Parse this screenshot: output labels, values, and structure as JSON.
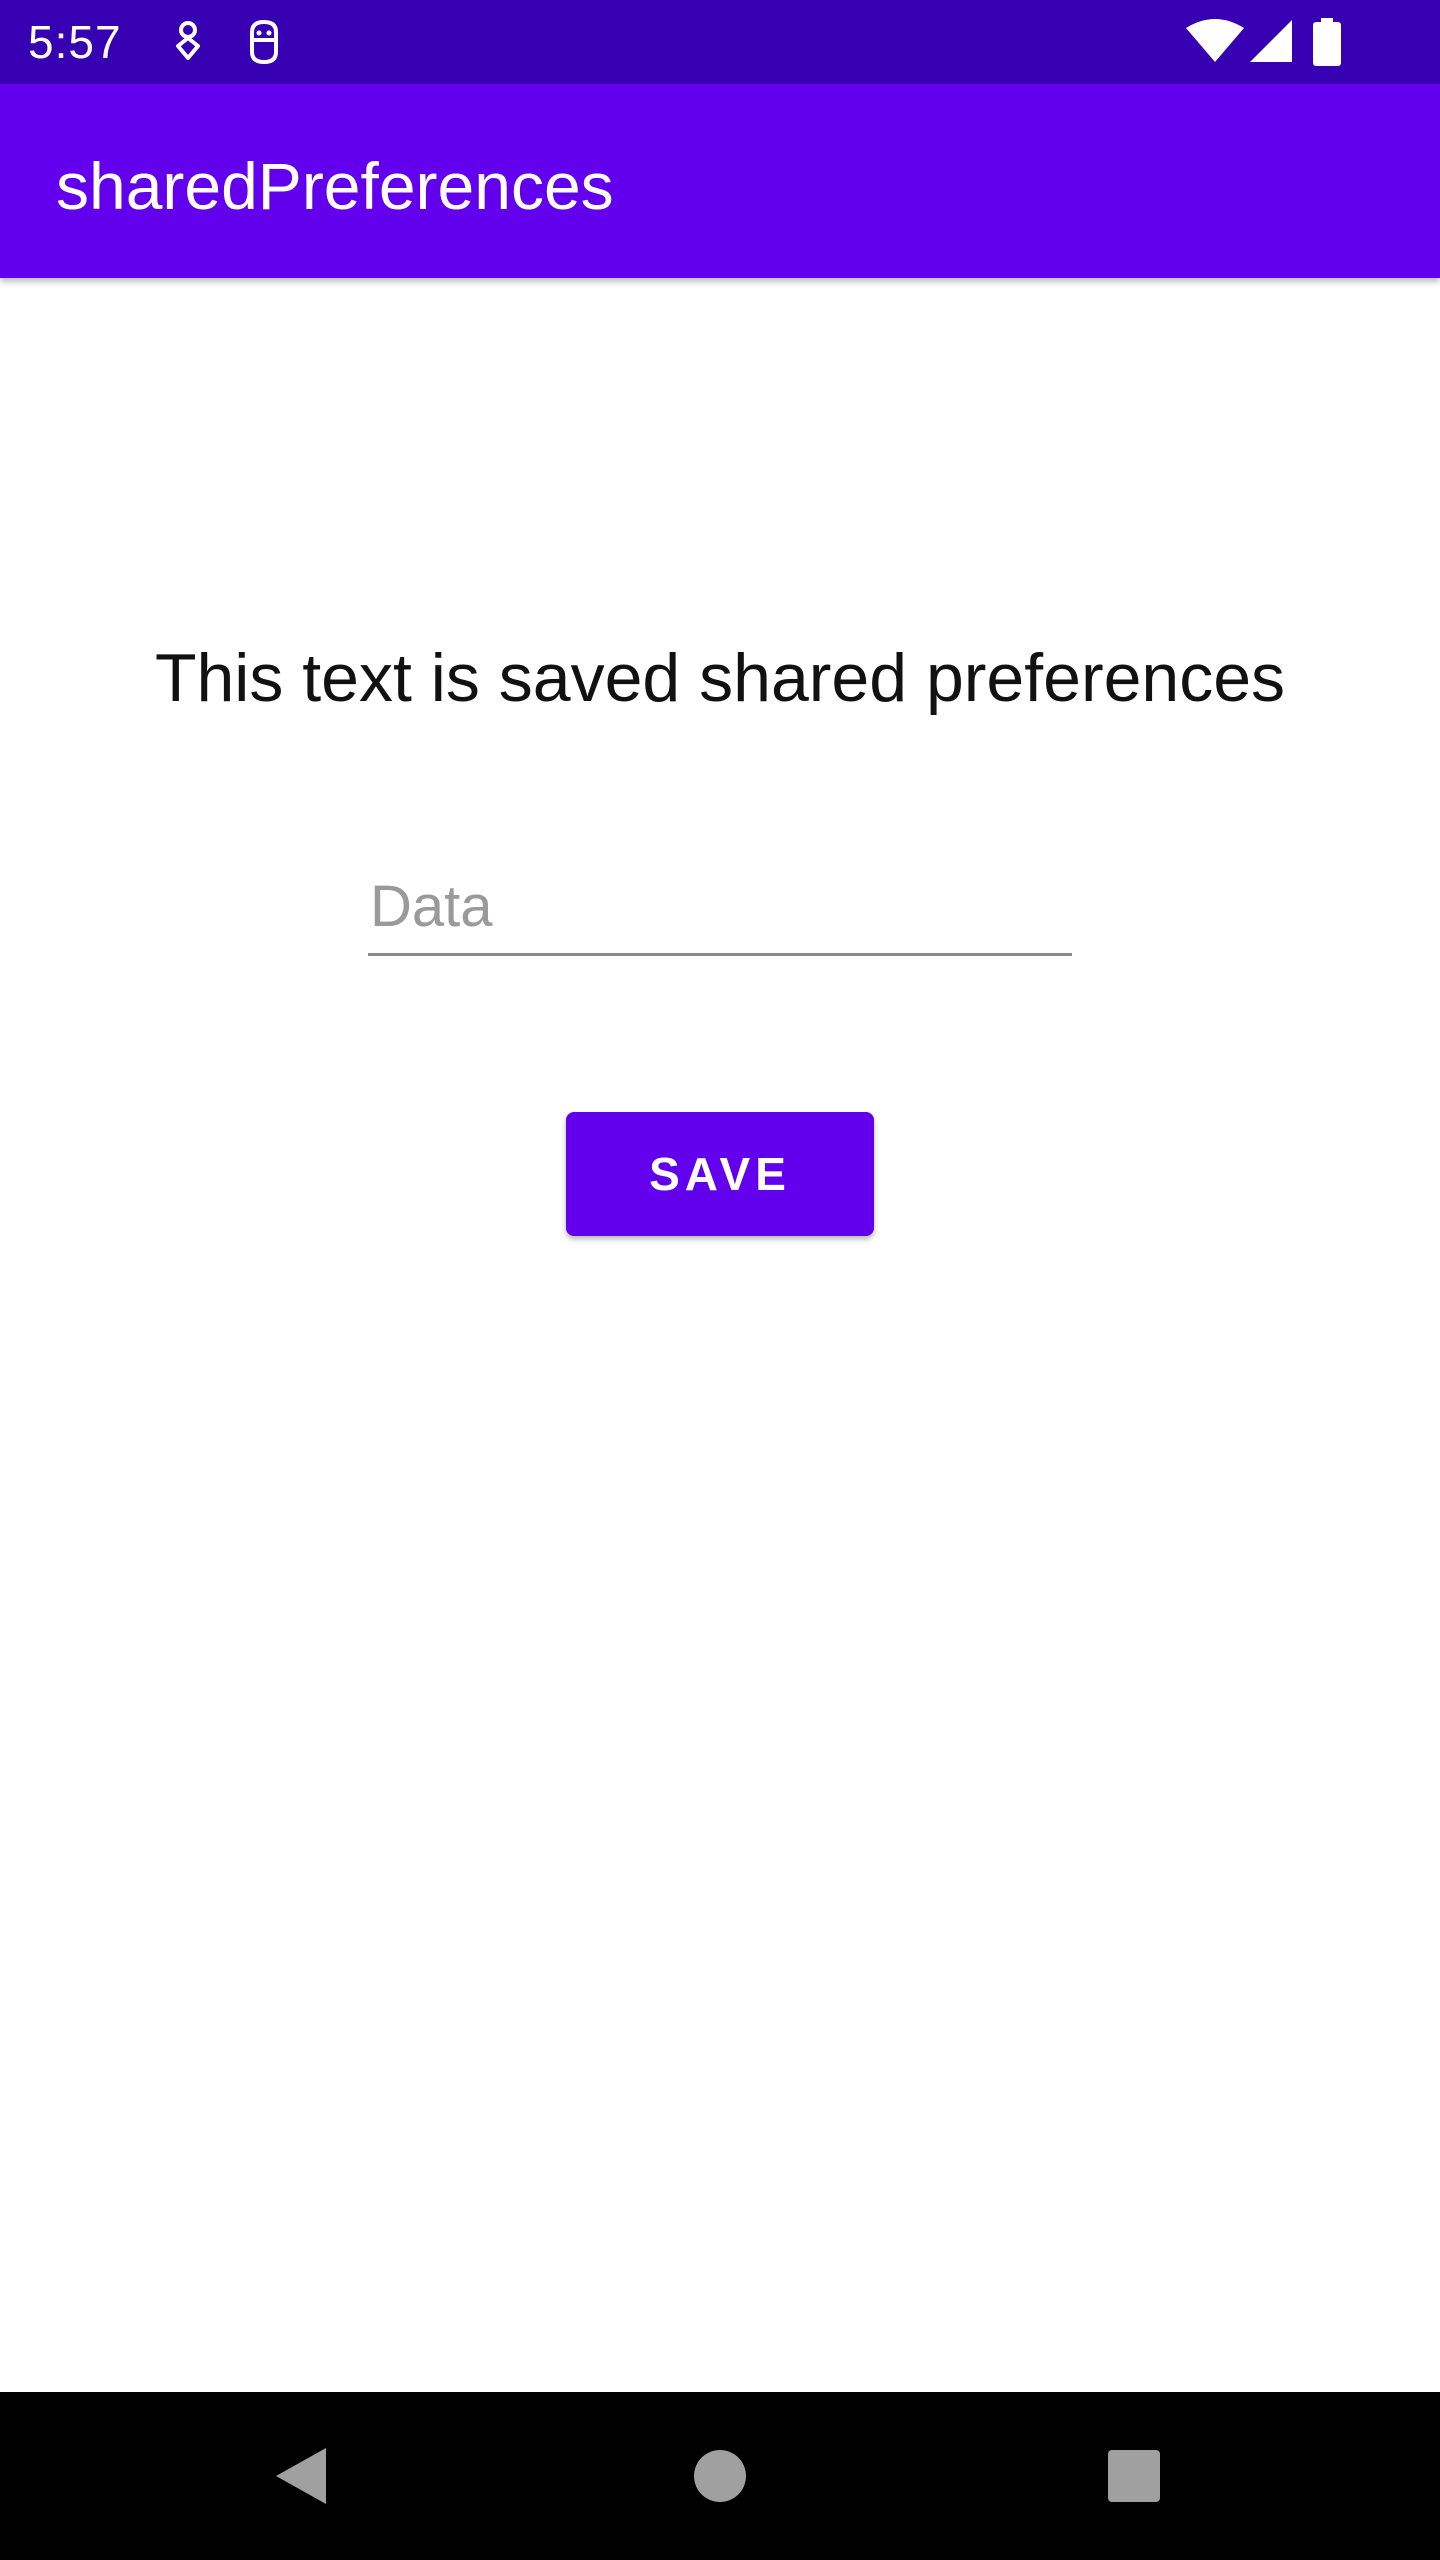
{
  "status_bar": {
    "time": "5:57",
    "left_icons": [
      "location-pin-icon",
      "android-debug-icon"
    ],
    "right_icons": [
      "wifi-icon",
      "cell-signal-icon",
      "battery-icon"
    ]
  },
  "app_bar": {
    "title": "sharedPreferences"
  },
  "main": {
    "label": "This text is saved shared preferences",
    "input": {
      "value": "",
      "placeholder": "Data"
    },
    "save_button_label": "SAVE"
  },
  "nav_bar": {
    "buttons": [
      "back-icon",
      "home-icon",
      "recents-icon"
    ]
  },
  "colors": {
    "status_bar": "#3700b3",
    "primary": "#6200ee",
    "background": "#ffffff",
    "nav_bar": "#000000"
  }
}
